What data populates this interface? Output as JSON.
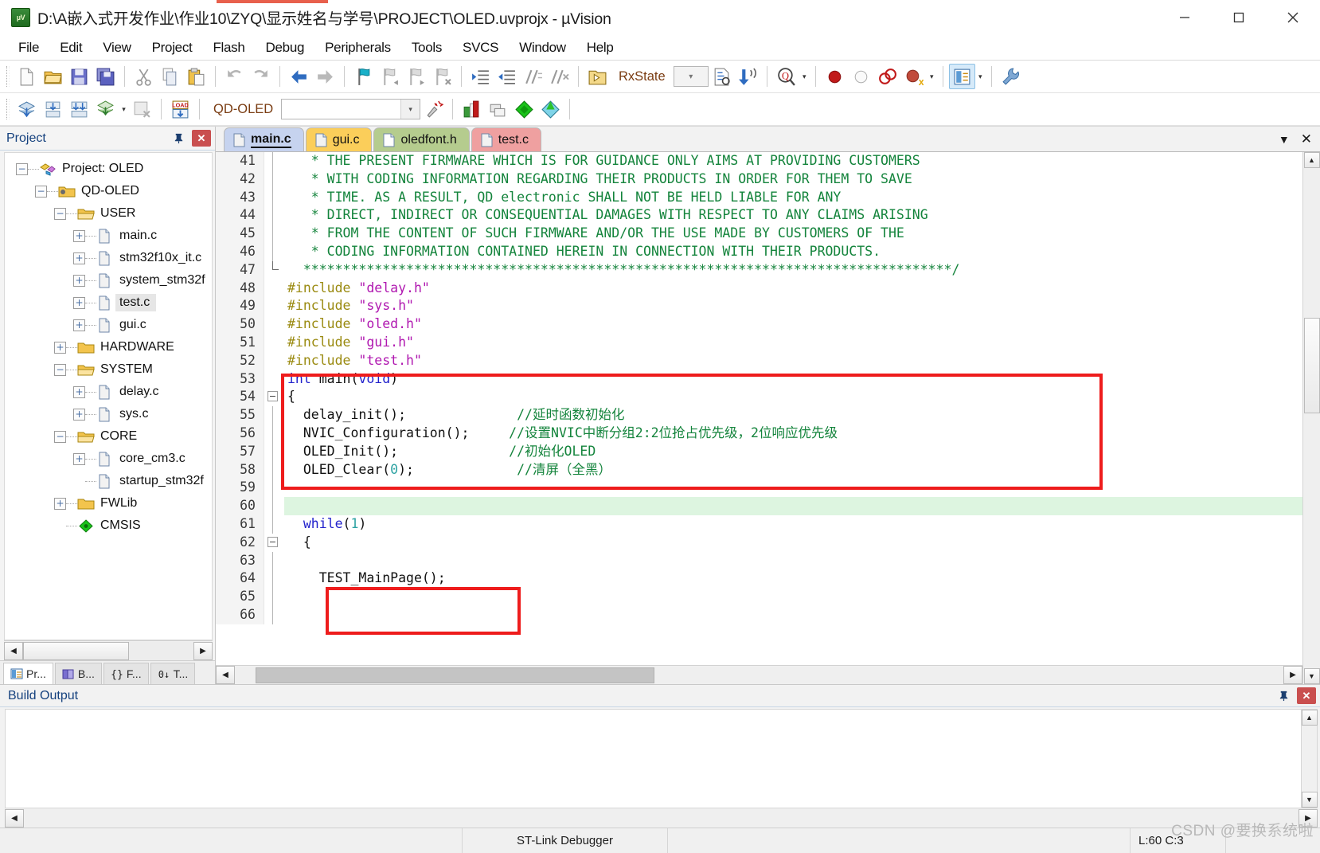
{
  "window": {
    "title": "D:\\A嵌入式开发作业\\作业10\\ZYQ\\显示姓名与学号\\PROJECT\\OLED.uvprojx - µVision",
    "app_icon": "uvision-icon",
    "minimize": "—",
    "maximize": "□",
    "close": "✕"
  },
  "menubar": {
    "items": [
      {
        "label": "File"
      },
      {
        "label": "Edit"
      },
      {
        "label": "View"
      },
      {
        "label": "Project"
      },
      {
        "label": "Flash"
      },
      {
        "label": "Debug"
      },
      {
        "label": "Peripherals"
      },
      {
        "label": "Tools"
      },
      {
        "label": "SVCS"
      },
      {
        "label": "Window"
      },
      {
        "label": "Help"
      }
    ]
  },
  "toolbar_main": {
    "buttons": [
      {
        "name": "new-file-icon"
      },
      {
        "name": "open-file-icon"
      },
      {
        "name": "save-icon"
      },
      {
        "name": "save-all-icon"
      },
      {
        "name": "cut-icon"
      },
      {
        "name": "copy-icon"
      },
      {
        "name": "paste-icon"
      },
      {
        "name": "undo-icon"
      },
      {
        "name": "redo-icon"
      },
      {
        "name": "navigate-back-icon"
      },
      {
        "name": "navigate-forward-icon"
      },
      {
        "name": "bookmark-toggle-icon"
      },
      {
        "name": "bookmark-prev-icon"
      },
      {
        "name": "bookmark-next-icon"
      },
      {
        "name": "bookmark-clear-icon"
      },
      {
        "name": "indent-icon"
      },
      {
        "name": "outdent-icon"
      },
      {
        "name": "comment-icon"
      },
      {
        "name": "uncomment-icon"
      },
      {
        "name": "insert-file-icon"
      }
    ],
    "search_label": "RxState",
    "right_buttons": [
      {
        "name": "find-in-files-icon"
      },
      {
        "name": "incremental-find-icon"
      },
      {
        "name": "magnifier-icon"
      },
      {
        "name": "breakpoint-insert-icon"
      },
      {
        "name": "breakpoint-disable-icon"
      },
      {
        "name": "breakpoint-kill-all-icon"
      },
      {
        "name": "breakpoint-disable-all-icon"
      },
      {
        "name": "configuration-wizard-icon"
      },
      {
        "name": "build-settings-icon"
      }
    ]
  },
  "toolbar_build": {
    "buttons": [
      {
        "name": "translate-icon"
      },
      {
        "name": "build-icon"
      },
      {
        "name": "rebuild-icon"
      },
      {
        "name": "batch-build-icon"
      },
      {
        "name": "stop-build-icon"
      },
      {
        "name": "download-icon"
      }
    ],
    "target_value": "QD-OLED",
    "right_buttons": [
      {
        "name": "target-options-icon"
      },
      {
        "name": "manage-components-icon"
      },
      {
        "name": "multi-project-icon"
      },
      {
        "name": "pack-installer-icon"
      },
      {
        "name": "manage-runtime-icon"
      }
    ]
  },
  "project_panel": {
    "title": "Project",
    "pin_icon": "pin-icon",
    "close_icon": "close-icon",
    "tree": [
      {
        "label": "Project: OLED",
        "depth": 0,
        "expander": "-",
        "icon": "project-icon"
      },
      {
        "label": "QD-OLED",
        "depth": 1,
        "expander": "-",
        "icon": "target-folder-icon"
      },
      {
        "label": "USER",
        "depth": 2,
        "expander": "-",
        "icon": "group-folder-icon"
      },
      {
        "label": "main.c",
        "depth": 3,
        "expander": "+",
        "icon": "c-file-icon"
      },
      {
        "label": "stm32f10x_it.c",
        "depth": 3,
        "expander": "+",
        "icon": "c-file-icon"
      },
      {
        "label": "system_stm32f",
        "depth": 3,
        "expander": "+",
        "icon": "c-file-icon"
      },
      {
        "label": "test.c",
        "depth": 3,
        "expander": "+",
        "icon": "c-file-icon",
        "selected": true
      },
      {
        "label": "gui.c",
        "depth": 3,
        "expander": "+",
        "icon": "c-file-icon"
      },
      {
        "label": "HARDWARE",
        "depth": 2,
        "expander": "+",
        "icon": "group-folder-closed-icon"
      },
      {
        "label": "SYSTEM",
        "depth": 2,
        "expander": "-",
        "icon": "group-folder-icon"
      },
      {
        "label": "delay.c",
        "depth": 3,
        "expander": "+",
        "icon": "c-file-icon"
      },
      {
        "label": "sys.c",
        "depth": 3,
        "expander": "+",
        "icon": "c-file-icon"
      },
      {
        "label": "CORE",
        "depth": 2,
        "expander": "-",
        "icon": "group-folder-icon"
      },
      {
        "label": "core_cm3.c",
        "depth": 3,
        "expander": "+",
        "icon": "c-file-icon"
      },
      {
        "label": "startup_stm32f",
        "depth": 3,
        "expander": "",
        "icon": "c-file-icon"
      },
      {
        "label": "FWLib",
        "depth": 2,
        "expander": "+",
        "icon": "group-folder-closed-icon"
      },
      {
        "label": "CMSIS",
        "depth": 2,
        "expander": "",
        "icon": "cmsis-icon"
      }
    ],
    "bottom_tabs": [
      {
        "label": "Pr...",
        "icon": "project-tab-icon",
        "active": true
      },
      {
        "label": "B...",
        "icon": "books-tab-icon",
        "active": false
      },
      {
        "label": "F...",
        "icon": "functions-tab-icon",
        "active": false
      },
      {
        "label": "T...",
        "icon": "templates-tab-icon",
        "active": false
      }
    ]
  },
  "editor": {
    "tabs": [
      {
        "label": "main.c",
        "active": true,
        "theme": "t-main"
      },
      {
        "label": "gui.c",
        "active": false,
        "theme": "t-gui"
      },
      {
        "label": "oledfont.h",
        "active": false,
        "theme": "t-oledfont"
      },
      {
        "label": "test.c",
        "active": false,
        "theme": "t-test"
      }
    ],
    "tabstrip_menu_icon": "chevron-down-icon",
    "tabstrip_close_icon": "close-icon",
    "first_line_number": 41,
    "lines": [
      {
        "n": 41,
        "fold": "bar",
        "segments": [
          {
            "t": "   * THE PRESENT FIRMWARE WHICH IS FOR GUIDANCE ONLY AIMS AT PROVIDING CUSTOMERS",
            "c": "cm"
          }
        ]
      },
      {
        "n": 42,
        "fold": "bar",
        "segments": [
          {
            "t": "   * WITH CODING INFORMATION REGARDING THEIR PRODUCTS IN ORDER FOR THEM TO SAVE",
            "c": "cm"
          }
        ]
      },
      {
        "n": 43,
        "fold": "bar",
        "segments": [
          {
            "t": "   * TIME. AS A RESULT, QD electronic SHALL NOT BE HELD LIABLE FOR ANY",
            "c": "cm"
          }
        ]
      },
      {
        "n": 44,
        "fold": "bar",
        "segments": [
          {
            "t": "   * DIRECT, INDIRECT OR CONSEQUENTIAL DAMAGES WITH RESPECT TO ANY CLAIMS ARISING",
            "c": "cm"
          }
        ]
      },
      {
        "n": 45,
        "fold": "bar",
        "segments": [
          {
            "t": "   * FROM THE CONTENT OF SUCH FIRMWARE AND/OR THE USE MADE BY CUSTOMERS OF THE",
            "c": "cm"
          }
        ]
      },
      {
        "n": 46,
        "fold": "bar",
        "segments": [
          {
            "t": "   * CODING INFORMATION CONTAINED HEREIN IN CONNECTION WITH THEIR PRODUCTS.",
            "c": "cm"
          }
        ]
      },
      {
        "n": 47,
        "fold": "end",
        "segments": [
          {
            "t": "  **********************************************************************************/",
            "c": "cm"
          }
        ]
      },
      {
        "n": 48,
        "fold": "",
        "segments": [
          {
            "t": "#include ",
            "c": "pp"
          },
          {
            "t": "\"delay.h\"",
            "c": "str"
          }
        ]
      },
      {
        "n": 49,
        "fold": "",
        "segments": [
          {
            "t": "#include ",
            "c": "pp"
          },
          {
            "t": "\"sys.h\"",
            "c": "str"
          }
        ]
      },
      {
        "n": 50,
        "fold": "",
        "segments": [
          {
            "t": "#include ",
            "c": "pp"
          },
          {
            "t": "\"oled.h\"",
            "c": "str"
          }
        ]
      },
      {
        "n": 51,
        "fold": "",
        "segments": [
          {
            "t": "#include ",
            "c": "pp"
          },
          {
            "t": "\"gui.h\"",
            "c": "str"
          }
        ]
      },
      {
        "n": 52,
        "fold": "",
        "segments": [
          {
            "t": "#include ",
            "c": "pp"
          },
          {
            "t": "\"test.h\"",
            "c": "str"
          }
        ]
      },
      {
        "n": 53,
        "fold": "",
        "segments": [
          {
            "t": "int ",
            "c": "kw"
          },
          {
            "t": "main(",
            "c": "pl"
          },
          {
            "t": "void",
            "c": "kw"
          },
          {
            "t": ")",
            "c": "pl"
          }
        ]
      },
      {
        "n": 54,
        "fold": "minus",
        "segments": [
          {
            "t": "{",
            "c": "pl"
          }
        ]
      },
      {
        "n": 55,
        "fold": "bar",
        "segments": [
          {
            "t": "  delay_init();",
            "c": "pl"
          },
          {
            "t": "              //延时函数初始化",
            "c": "cm"
          }
        ]
      },
      {
        "n": 56,
        "fold": "bar",
        "segments": [
          {
            "t": "  NVIC_Configuration();",
            "c": "pl"
          },
          {
            "t": "     //设置NVIC中断分组2:2位抢占优先级，2位响应优先级",
            "c": "cm"
          }
        ]
      },
      {
        "n": 57,
        "fold": "bar",
        "segments": [
          {
            "t": "  OLED_Init();",
            "c": "pl"
          },
          {
            "t": "              //初始化OLED",
            "c": "cm"
          }
        ]
      },
      {
        "n": 58,
        "fold": "bar",
        "segments": [
          {
            "t": "  OLED_Clear(",
            "c": "pl"
          },
          {
            "t": "0",
            "c": "num"
          },
          {
            "t": ");",
            "c": "pl"
          },
          {
            "t": "             //清屏（全黑）",
            "c": "cm"
          }
        ]
      },
      {
        "n": 59,
        "fold": "bar",
        "segments": [
          {
            "t": "",
            "c": "pl"
          }
        ]
      },
      {
        "n": 60,
        "fold": "bar",
        "modified": true,
        "segments": [
          {
            "t": "",
            "c": "pl"
          }
        ]
      },
      {
        "n": 61,
        "fold": "bar",
        "segments": [
          {
            "t": "  while",
            "c": "kw"
          },
          {
            "t": "(",
            "c": "pl"
          },
          {
            "t": "1",
            "c": "num"
          },
          {
            "t": ")",
            "c": "pl"
          }
        ]
      },
      {
        "n": 62,
        "fold": "minus",
        "segments": [
          {
            "t": "  {",
            "c": "pl"
          }
        ]
      },
      {
        "n": 63,
        "fold": "bar",
        "segments": [
          {
            "t": "",
            "c": "pl"
          }
        ]
      },
      {
        "n": 64,
        "fold": "bar",
        "segments": [
          {
            "t": "    TEST_MainPage();",
            "c": "pl"
          }
        ]
      },
      {
        "n": 65,
        "fold": "bar",
        "segments": [
          {
            "t": "",
            "c": "pl"
          }
        ]
      },
      {
        "n": 66,
        "fold": "bar",
        "segments": [
          {
            "t": "",
            "c": "pl"
          }
        ]
      }
    ],
    "annotations": [
      {
        "name": "highlight-box-main-init",
        "color": "#ee1c1c"
      },
      {
        "name": "highlight-box-test-mainpage",
        "color": "#ee1c1c"
      }
    ]
  },
  "build_output": {
    "title": "Build Output",
    "pin_icon": "pin-icon",
    "close_icon": "close-icon",
    "content": ""
  },
  "statusbar": {
    "message": "",
    "debugger": "ST-Link Debugger",
    "position": "L:60 C:3",
    "extra": ""
  },
  "watermark": {
    "text": "CSDN @要换系统啦"
  },
  "colors": {
    "accent_red": "#ee1c1c",
    "comment_green": "#14843c",
    "keyword_blue": "#2222cc",
    "preprocessor": "#9a8a10",
    "string_magenta": "#b018b0",
    "panel_title_blue": "#15417e",
    "modified_line": "#ddf5e0"
  }
}
